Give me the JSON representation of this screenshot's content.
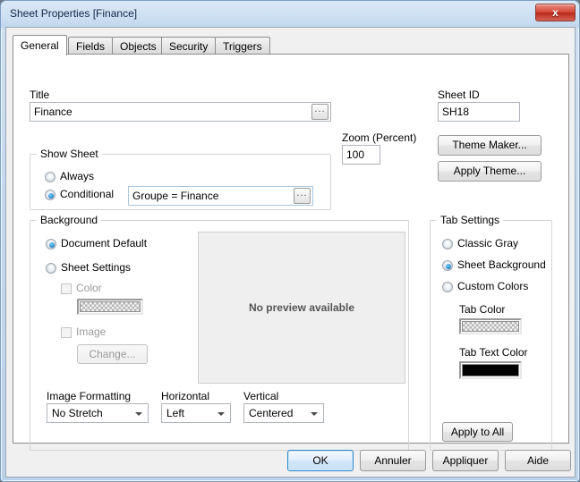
{
  "window": {
    "title": "Sheet Properties [Finance]",
    "close_label": "x",
    "close_icon": "close-icon"
  },
  "tabs": [
    {
      "label": "General",
      "active": true
    },
    {
      "label": "Fields",
      "active": false
    },
    {
      "label": "Objects",
      "active": false
    },
    {
      "label": "Security",
      "active": false
    },
    {
      "label": "Triggers",
      "active": false
    }
  ],
  "general": {
    "title_label": "Title",
    "title_value": "Finance",
    "title_browse_label": "...",
    "sheet_id_label": "Sheet ID",
    "sheet_id_value": "SH18",
    "zoom_label": "Zoom (Percent)",
    "zoom_value": "100",
    "theme_maker_label": "Theme Maker...",
    "apply_theme_label": "Apply Theme...",
    "show_sheet": {
      "group_label": "Show Sheet",
      "always_label": "Always",
      "conditional_label": "Conditional",
      "selected": "Conditional",
      "condition_value": "Groupe = Finance",
      "condition_browse_label": "..."
    },
    "background": {
      "group_label": "Background",
      "document_default_label": "Document Default",
      "sheet_settings_label": "Sheet Settings",
      "selected": "Document Default",
      "color_label": "Color",
      "color_checked": false,
      "color_swatch": "checkered",
      "image_label": "Image",
      "image_checked": false,
      "change_label": "Change...",
      "image_formatting_label": "Image Formatting",
      "image_formatting_value": "No Stretch",
      "horizontal_label": "Horizontal",
      "horizontal_value": "Left",
      "vertical_label": "Vertical",
      "vertical_value": "Centered"
    },
    "preview": {
      "text": "No preview available"
    },
    "tab_settings": {
      "group_label": "Tab Settings",
      "classic_gray_label": "Classic Gray",
      "sheet_background_label": "Sheet Background",
      "custom_colors_label": "Custom Colors",
      "selected": "Sheet Background",
      "tab_color_label": "Tab Color",
      "tab_color_swatch": "checkered",
      "tab_text_color_label": "Tab Text Color",
      "tab_text_color_value": "#000000",
      "apply_to_all_label": "Apply to All"
    }
  },
  "footer": {
    "ok_label": "OK",
    "cancel_label": "Annuler",
    "apply_label": "Appliquer",
    "help_label": "Aide"
  },
  "colors": {
    "accent": "#2c87c9",
    "radio_dot": "#1d7fc4",
    "titlebar": "#cfe0f2",
    "close_red": "#d4483a",
    "tab_text_color": "#000000"
  }
}
